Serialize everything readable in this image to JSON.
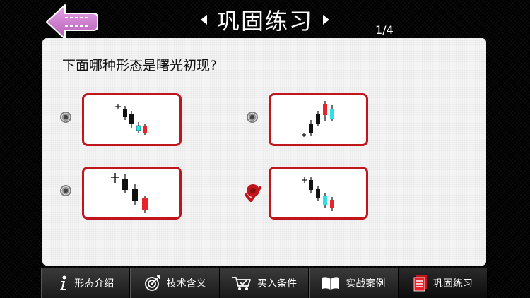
{
  "header": {
    "title": "巩固练习",
    "page_counter": "1/4",
    "back_icon": "back-arrow-icon",
    "accent_color": "#c77ac8"
  },
  "question": {
    "text": "下面哪种形态是曙光初现?",
    "options": [
      {
        "id": "A",
        "selected": false,
        "pattern": "doji-then-falling-black-candles-cyan-red"
      },
      {
        "id": "B",
        "selected": false,
        "pattern": "doji-then-rising-black-candles-red-cyan"
      },
      {
        "id": "C",
        "selected": false,
        "pattern": "doji-then-falling-black-candles-red"
      },
      {
        "id": "D",
        "selected": true,
        "pattern": "doji-then-falling-black-cyan-red"
      }
    ]
  },
  "tabs": [
    {
      "label": "形态介绍",
      "icon": "info-icon",
      "active": false
    },
    {
      "label": "技术含义",
      "icon": "target-icon",
      "active": false
    },
    {
      "label": "买入条件",
      "icon": "cart-icon",
      "active": false
    },
    {
      "label": "实战案例",
      "icon": "book-icon",
      "active": false
    },
    {
      "label": "巩固练习",
      "icon": "notes-icon",
      "active": true
    }
  ],
  "colors": {
    "frame_red": "#c0151c",
    "candle_red": "#e8232a",
    "candle_cyan": "#2fe0e6",
    "candle_black": "#111111"
  }
}
